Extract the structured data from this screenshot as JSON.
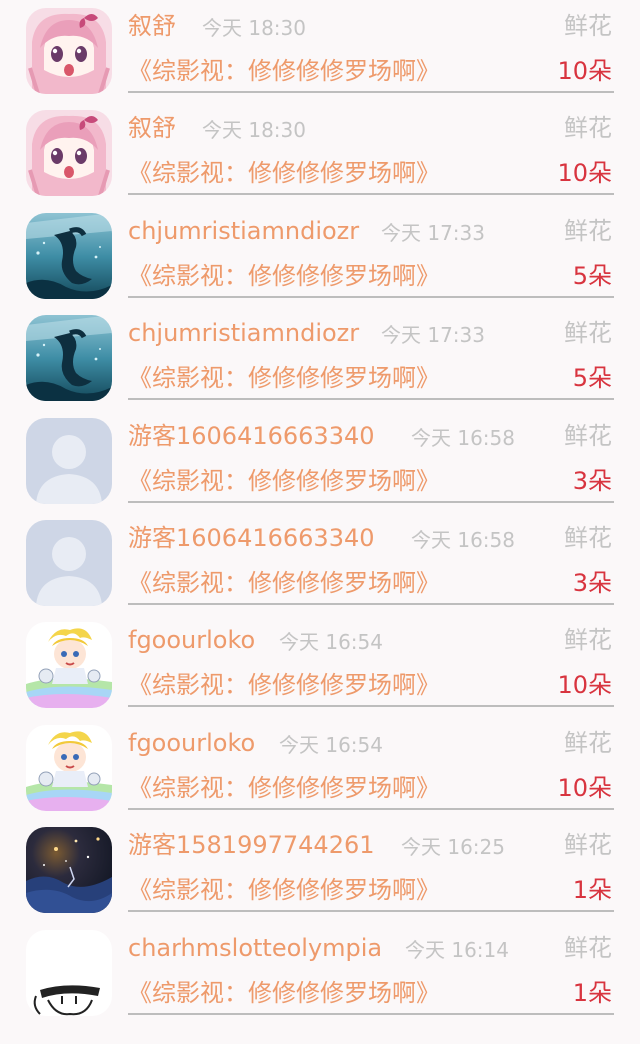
{
  "colors": {
    "name": "#ee9a6b",
    "book": "#ee9a6b",
    "meta": "#c4c4c4",
    "count": "#d8343f",
    "divider": "#bdbdbd",
    "background": "#fbf8f9"
  },
  "rows": [
    {
      "avatar": "anime-pink-girl-avatar",
      "name": "叙舒",
      "time": "今天 18:30",
      "gift": "鲜花",
      "book": "《综影视：修修修修罗场啊》",
      "count": "10朵"
    },
    {
      "avatar": "anime-pink-girl-avatar",
      "name": "叙舒",
      "time": "今天 18:30",
      "gift": "鲜花",
      "book": "《综影视：修修修修罗场啊》",
      "count": "10朵"
    },
    {
      "avatar": "underwater-figure-avatar",
      "name": "chjumristiamndiozr",
      "time": "今天 17:33",
      "gift": "鲜花",
      "book": "《综影视：修修修修罗场啊》",
      "count": "5朵"
    },
    {
      "avatar": "underwater-figure-avatar",
      "name": "chjumristiamndiozr",
      "time": "今天 17:33",
      "gift": "鲜花",
      "book": "《综影视：修修修修罗场啊》",
      "count": "5朵"
    },
    {
      "avatar": "default-user-silhouette-avatar",
      "name": "游客1606416663340",
      "time": "今天 16:58",
      "gift": "鲜花",
      "book": "《综影视：修修修修罗场啊》",
      "count": "3朵"
    },
    {
      "avatar": "default-user-silhouette-avatar",
      "name": "游客1606416663340",
      "time": "今天 16:58",
      "gift": "鲜花",
      "book": "《综影视：修修修修罗场啊》",
      "count": "3朵"
    },
    {
      "avatar": "cartoon-blonde-rainbow-avatar",
      "name": "fgoourloko",
      "time": "今天 16:54",
      "gift": "鲜花",
      "book": "《综影视：修修修修罗场啊》",
      "count": "10朵"
    },
    {
      "avatar": "cartoon-blonde-rainbow-avatar",
      "name": "fgoourloko",
      "time": "今天 16:54",
      "gift": "鲜花",
      "book": "《综影视：修修修修罗场啊》",
      "count": "10朵"
    },
    {
      "avatar": "night-sky-avatar",
      "name": "游客1581997744261",
      "time": "今天 16:25",
      "gift": "鲜花",
      "book": "《综影视：修修修修罗场啊》",
      "count": "1朵"
    },
    {
      "avatar": "sketch-person-avatar",
      "name": "charhmslotteolympia",
      "time": "今天 16:14",
      "gift": "鲜花",
      "book": "《综影视：修修修修罗场啊》",
      "count": "1朵"
    }
  ]
}
